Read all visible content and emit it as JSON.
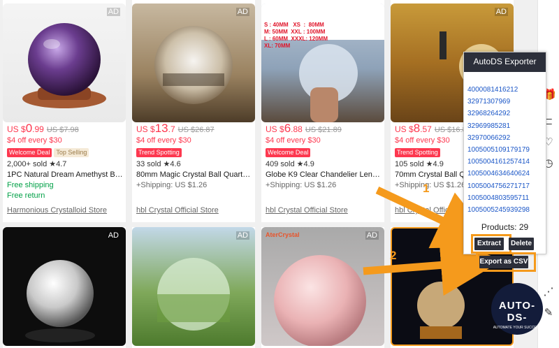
{
  "ad_label": "AD",
  "products": [
    {
      "currency": "US $",
      "price_big": "0",
      "price_small": ".99",
      "old_price": "US $7.98",
      "offer": "$4 off every $30",
      "tags": [
        {
          "label": "Welcome Deal",
          "style": "red"
        },
        {
          "label": "Top Selling",
          "style": "grey"
        }
      ],
      "sold": "2,000+ sold",
      "rating": "4.7",
      "title": "1PC Natural Dream Amethyst Ball ...",
      "shipping": "Free shipping",
      "extra": "Free return",
      "store": "Harmonious Crystalloid Store"
    },
    {
      "currency": "US $",
      "price_big": "13",
      "price_small": ".7",
      "old_price": "US $26.87",
      "offer": "$4 off every $30",
      "tags": [
        {
          "label": "Trend Spotting",
          "style": "red"
        }
      ],
      "sold": "33 sold",
      "rating": "4.6",
      "title": "80mm Magic Crystal Ball Quartz Fe...",
      "shipping": "+Shipping: US $1.26",
      "extra": "",
      "store": "hbl Crystal Official Store"
    },
    {
      "currency": "US $",
      "price_big": "6",
      "price_small": ".88",
      "old_price": "US $21.89",
      "offer": "$4 off every $30",
      "tags": [
        {
          "label": "Welcome Deal",
          "style": "red"
        }
      ],
      "sold": "409 sold",
      "rating": "4.9",
      "title": "Globe K9 Clear Chandelier Lens Ba...",
      "shipping": "+Shipping: US $1.26",
      "extra": "",
      "store": "hbl Crystal Official Store"
    },
    {
      "currency": "US $",
      "price_big": "8",
      "price_small": ".57",
      "old_price": "US $16.81",
      "offer": "$4 off every $30",
      "tags": [
        {
          "label": "Trend Spotting",
          "style": "red"
        }
      ],
      "sold": "105 sold",
      "rating": "4.9",
      "title": "70mm Crystal Ball Qua...",
      "shipping": "+Shipping: US $1.26",
      "extra": "",
      "store": "hbl Crystal Official Store"
    }
  ],
  "size_chart": [
    "S : 40MM   XS  :  80MM",
    "M: 50MM  XXL : 100MM",
    "L : 60MM  XXXL: 120MM",
    "XL: 70MM"
  ],
  "brand_watermark": "AterCrystal",
  "exporter": {
    "title": "AutoDS Exporter",
    "ids": [
      "4000081416212",
      "32971307969",
      "32968264292",
      "32969985281",
      "32970066292",
      "1005005109179179",
      "1005004161257414",
      "1005004634640624",
      "1005004756271717",
      "1005004803595711",
      "1005005245939298"
    ],
    "products_count": "Products: 29",
    "extract_label": "Extract",
    "delete_label": "Delete",
    "export_label": "Export as CSV"
  },
  "callouts": {
    "one": "1",
    "two": "2"
  },
  "logo": {
    "name": "AUTO-DS-",
    "tagline": "AUTOMATE YOUR SUCCESS"
  },
  "colors": {
    "price_red": "#fd384f",
    "arrow_orange": "#f59a1c",
    "exporter_dark": "#2c2f3a"
  }
}
